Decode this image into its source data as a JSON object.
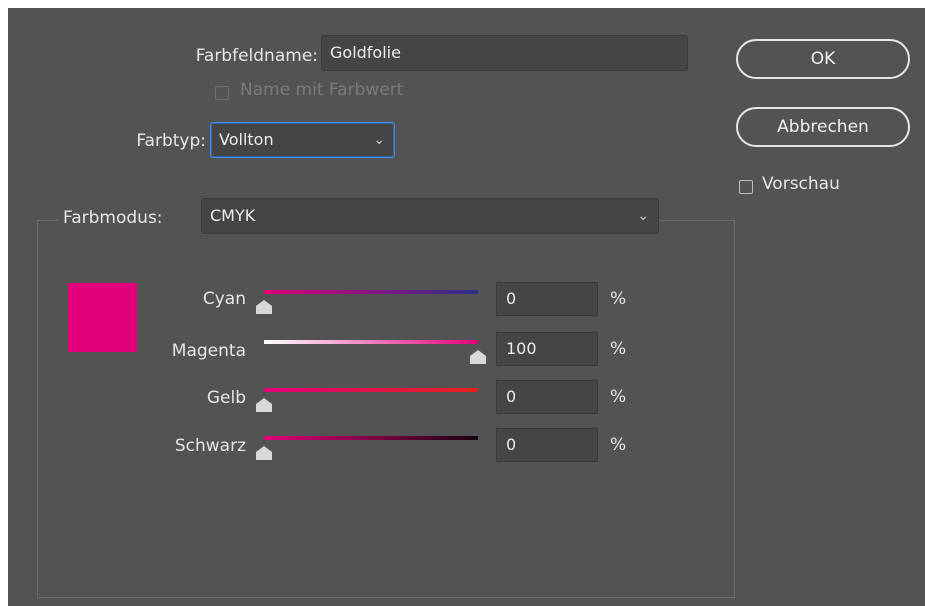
{
  "dialog": {
    "swatch_name_label": "Farbfeldname:",
    "swatch_name_value": "Goldfolie",
    "name_with_value_label": "Name mit Farbwert",
    "color_type_label": "Farbtyp:",
    "color_type_value": "Vollton",
    "color_mode_label": "Farbmodus:",
    "color_mode_value": "CMYK",
    "ok_label": "OK",
    "cancel_label": "Abbrechen",
    "preview_label": "Vorschau",
    "swatch_color": "#e2007a",
    "channels": [
      {
        "label": "Cyan",
        "value": "0",
        "unit": "%",
        "level": 0
      },
      {
        "label": "Magenta",
        "value": "100",
        "unit": "%",
        "level": 100
      },
      {
        "label": "Gelb",
        "value": "0",
        "unit": "%",
        "level": 0
      },
      {
        "label": "Schwarz",
        "value": "0",
        "unit": "%",
        "level": 0
      }
    ]
  },
  "colors": {
    "background": "#535353",
    "field": "#454545",
    "focus_border": "#3d8ee0",
    "cyan_track_end": "#2b2f8a",
    "magenta_track_start": "#ffffff",
    "gelb_track_end": "#e2231a",
    "schwarz_track_end": "#1a0010"
  }
}
